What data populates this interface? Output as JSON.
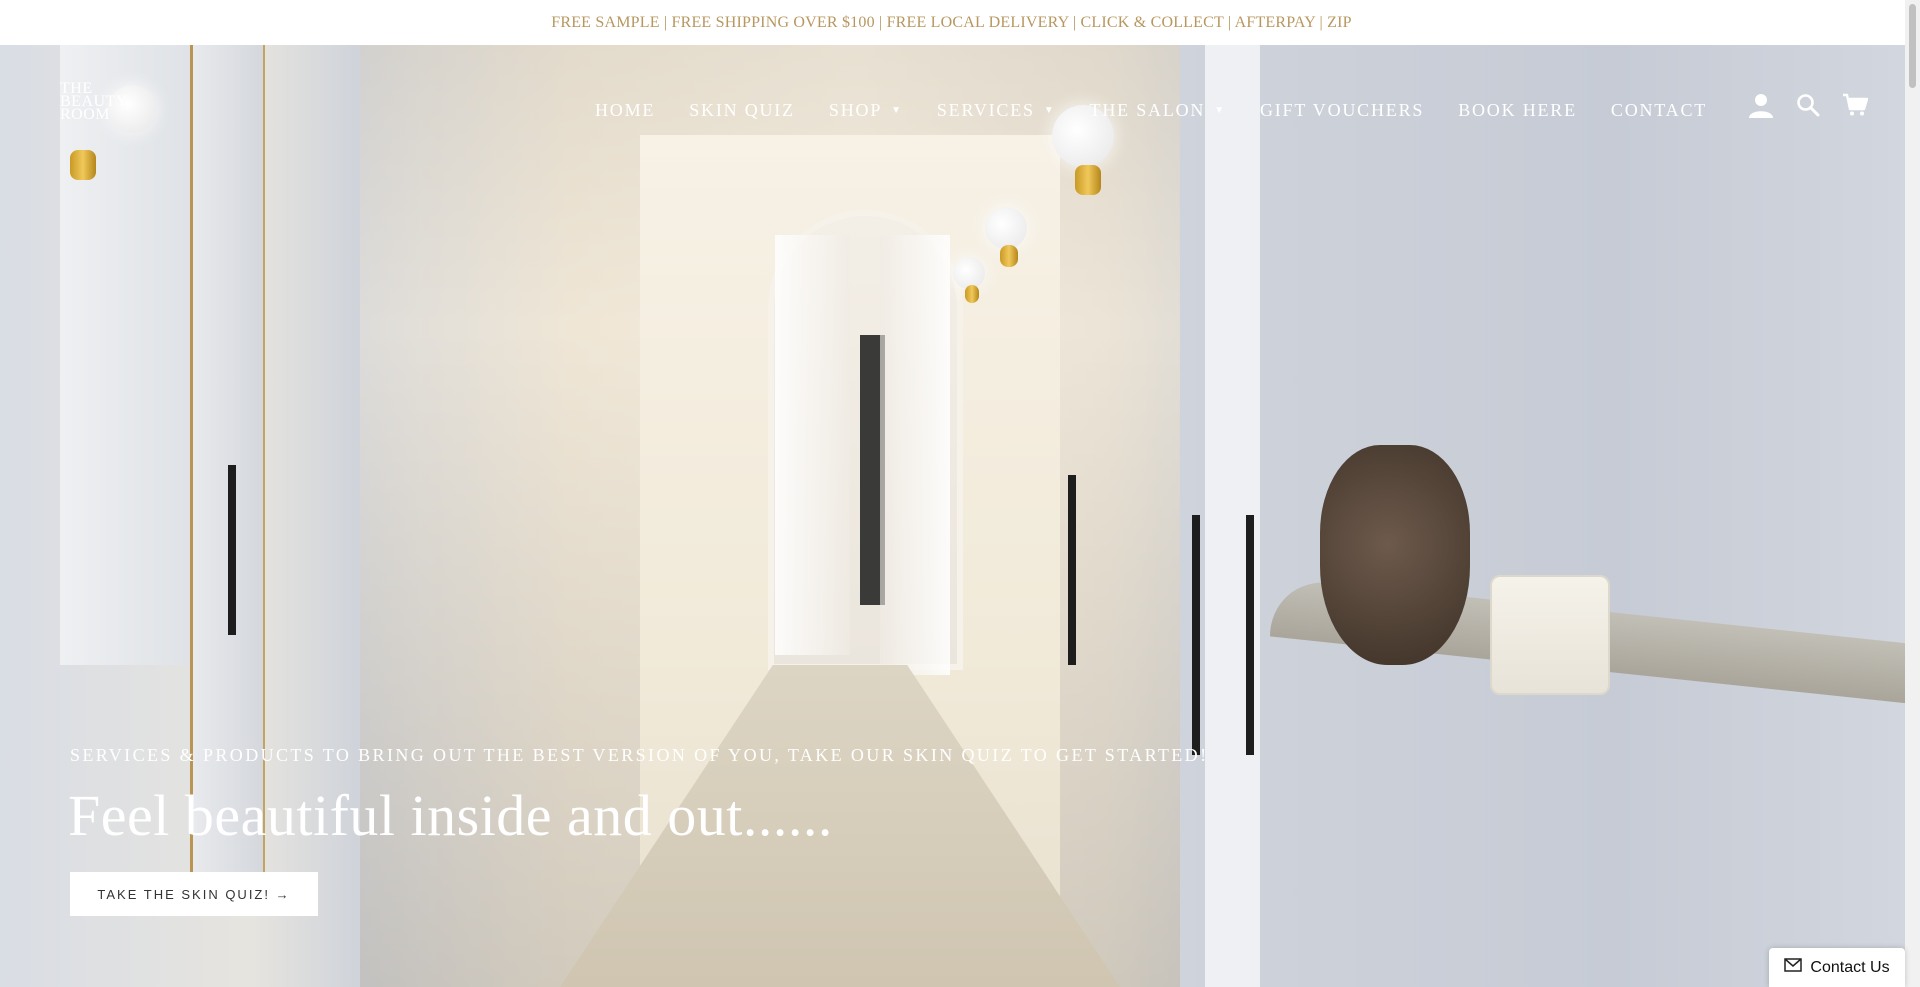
{
  "announcement": {
    "text": "FREE SAMPLE | FREE SHIPPING OVER $100 | FREE LOCAL DELIVERY | CLICK & COLLECT | AFTERPAY | ZIP"
  },
  "header": {
    "logo_lines": [
      "THE",
      "BEAUTY",
      "ROOM"
    ],
    "nav": [
      {
        "label": "HOME",
        "dropdown": false
      },
      {
        "label": "SKIN QUIZ",
        "dropdown": false
      },
      {
        "label": "SHOP",
        "dropdown": true
      },
      {
        "label": "SERVICES",
        "dropdown": true
      },
      {
        "label": "THE SALON",
        "dropdown": true
      },
      {
        "label": "GIFT VOUCHERS",
        "dropdown": false
      },
      {
        "label": "BOOK HERE",
        "dropdown": false
      },
      {
        "label": "CONTACT",
        "dropdown": false
      }
    ],
    "icons": [
      "account-icon",
      "search-icon",
      "cart-icon"
    ]
  },
  "hero": {
    "subtitle": "SERVICES & PRODUCTS TO BRING OUT THE BEST VERSION OF YOU, TAKE OUR SKIN QUIZ TO GET STARTED!",
    "headline": "Feel beautiful inside and out......",
    "cta_label": "TAKE THE SKIN QUIZ! →"
  },
  "contact_widget": {
    "label": "Contact Us",
    "icon": "envelope-icon"
  },
  "colors": {
    "announcement_text": "#b8975f",
    "hero_text": "#ffffff",
    "cta_background": "#ffffff"
  }
}
